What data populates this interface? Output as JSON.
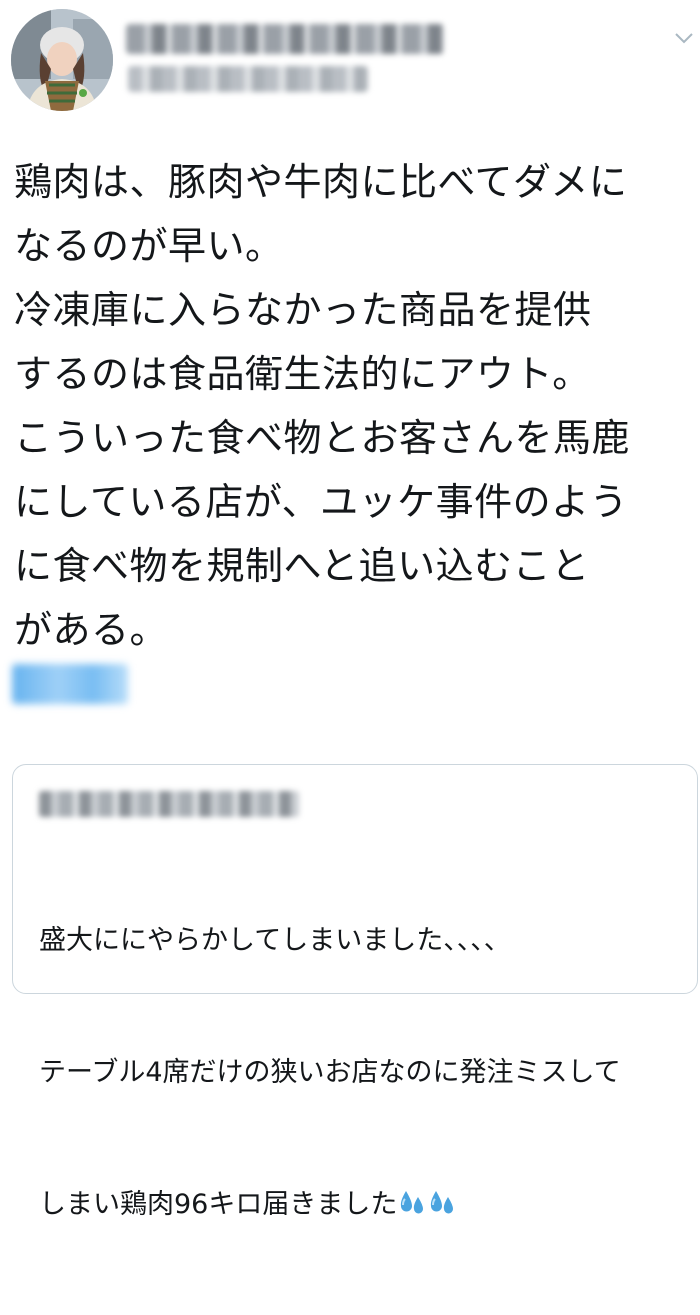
{
  "tweet": {
    "author": {
      "display_name": "",
      "handle": ""
    },
    "text": "鶏肉は、豚肉や牛肉に比べてダメに\nなるのが早い。\n冷凍庫に入らなかった商品を提供\nするのは食品衛生法的にアウト。\nこういった食べ物とお客さんを馬鹿\nにしている店が、ユッケ事件のよう\nに食べ物を規制へと追い込むこと\nがある。",
    "menu_icon": "chevron-down-icon"
  },
  "quoted_tweet": {
    "author": "",
    "lines": [
      "盛大ににやらかしてしまいました、、、、",
      "テーブル4席だけの狭いお店なのに発注ミスして",
      "しまい鶏肉96キロ届きました"
    ],
    "emoji": "sweat-droplets-icon"
  },
  "colors": {
    "link": "#1da1f2",
    "border": "#ccd6dd",
    "text": "#14171a"
  }
}
